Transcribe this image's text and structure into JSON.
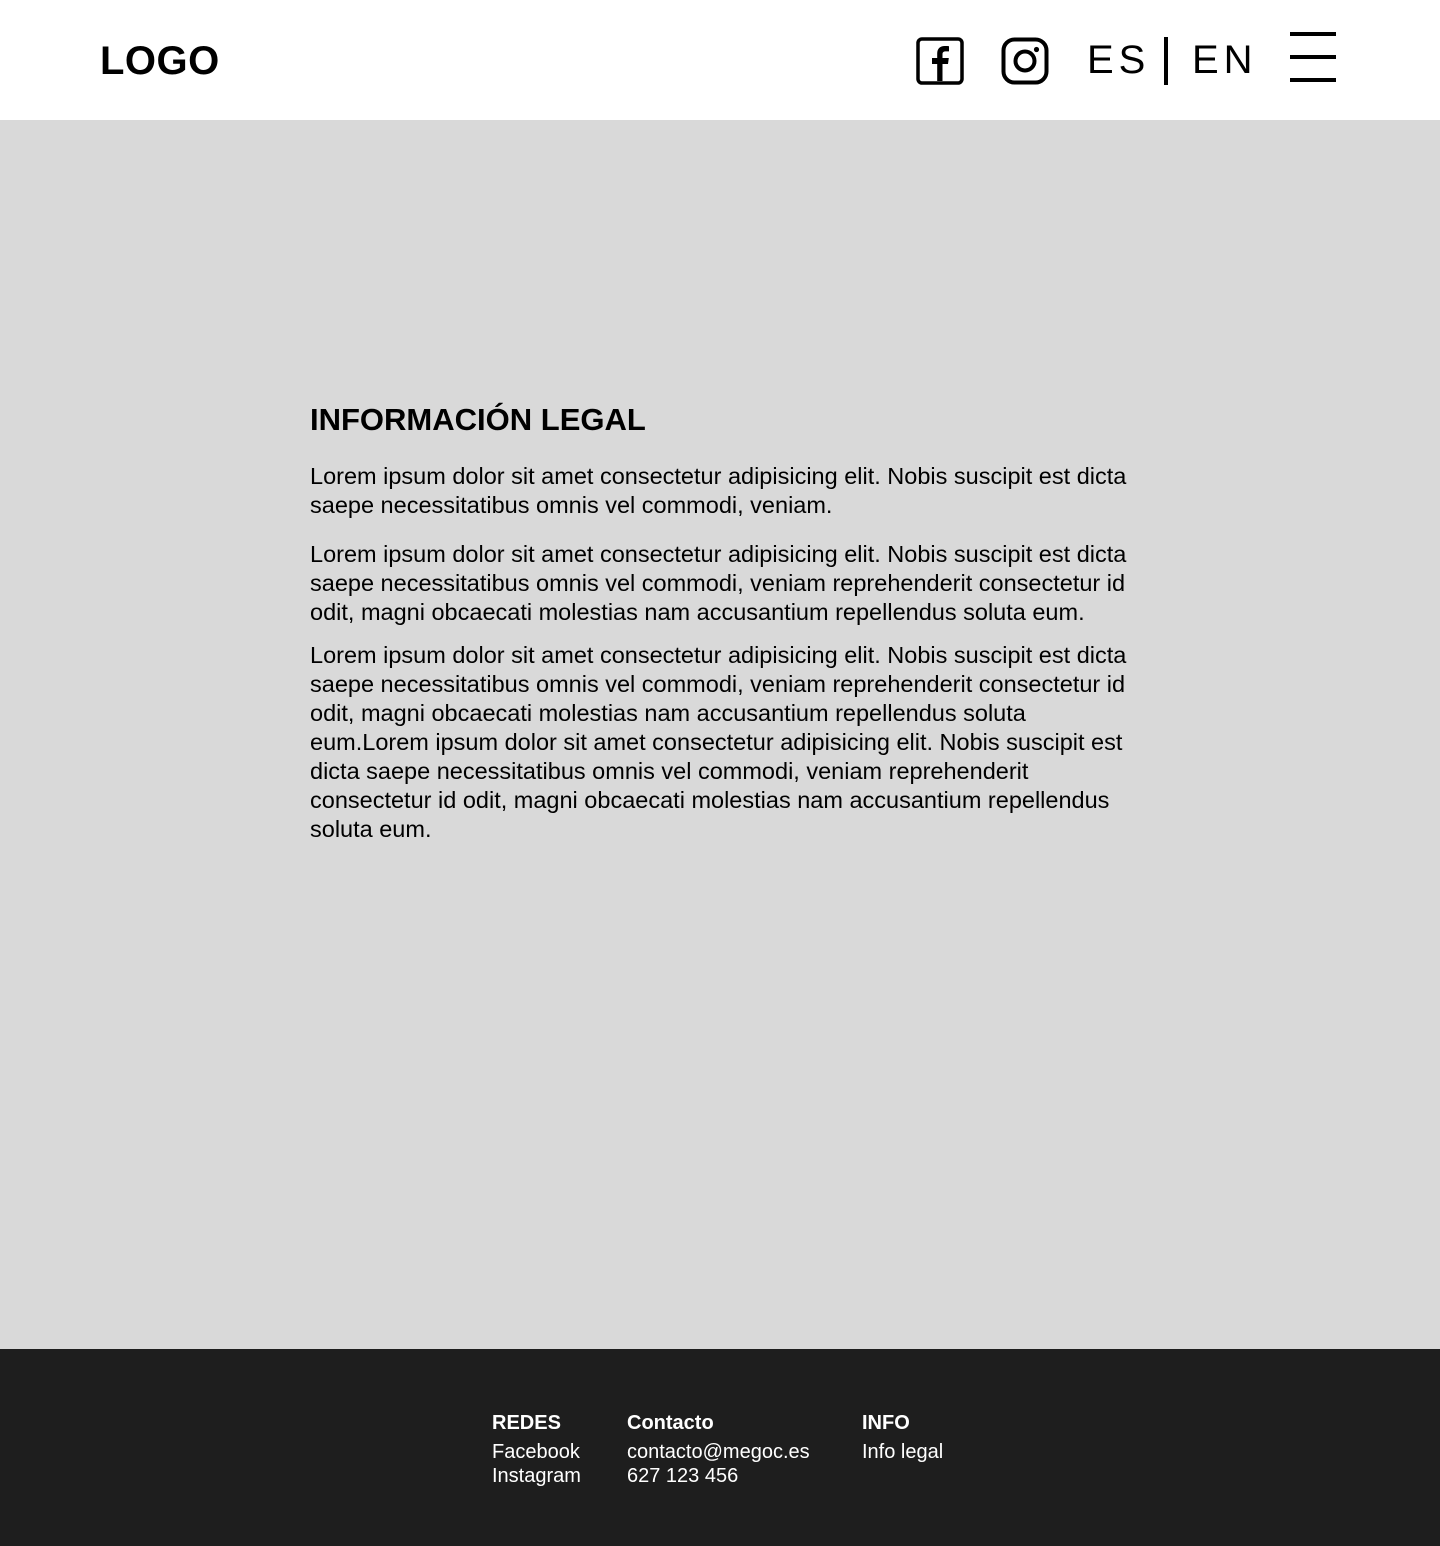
{
  "header": {
    "logo": "LOGO",
    "social_icons": [
      "facebook-icon",
      "instagram-icon"
    ],
    "lang_es": "ES",
    "lang_en": "EN",
    "menu_icon": "hamburger-menu-icon"
  },
  "main": {
    "title": "INFORMACIÓN LEGAL",
    "paragraphs": [
      "Lorem ipsum dolor sit amet consectetur adipisicing elit. Nobis suscipit est dicta saepe necessitatibus omnis vel commodi, veniam.",
      "Lorem ipsum dolor sit amet consectetur adipisicing elit. Nobis suscipit est dicta saepe necessitatibus omnis vel commodi, veniam reprehenderit consectetur id odit, magni obcaecati molestias nam accusantium repellendus soluta eum.",
      "Lorem ipsum dolor sit amet consectetur adipisicing elit. Nobis suscipit est dicta saepe necessitatibus omnis vel commodi, veniam reprehenderit consectetur id odit, magni obcaecati molestias nam accusantium repellendus soluta eum.Lorem ipsum dolor sit amet consectetur adipisicing elit. Nobis suscipit est dicta saepe necessitatibus omnis vel commodi, veniam reprehenderit consectetur id odit, magni obcaecati molestias nam accusantium repellendus soluta eum."
    ]
  },
  "footer": {
    "redes": {
      "heading": "REDES",
      "links": [
        "Facebook",
        "Instagram"
      ]
    },
    "contacto": {
      "heading": "Contacto",
      "email": "contacto@megoc.es",
      "phone": "627 123 456"
    },
    "info": {
      "heading": "INFO",
      "links": [
        "Info legal"
      ]
    }
  },
  "colors": {
    "header_bg": "#ffffff",
    "main_bg": "#d9d9d9",
    "footer_bg": "#1e1e1e",
    "text": "#000000",
    "footer_text": "#ffffff"
  }
}
